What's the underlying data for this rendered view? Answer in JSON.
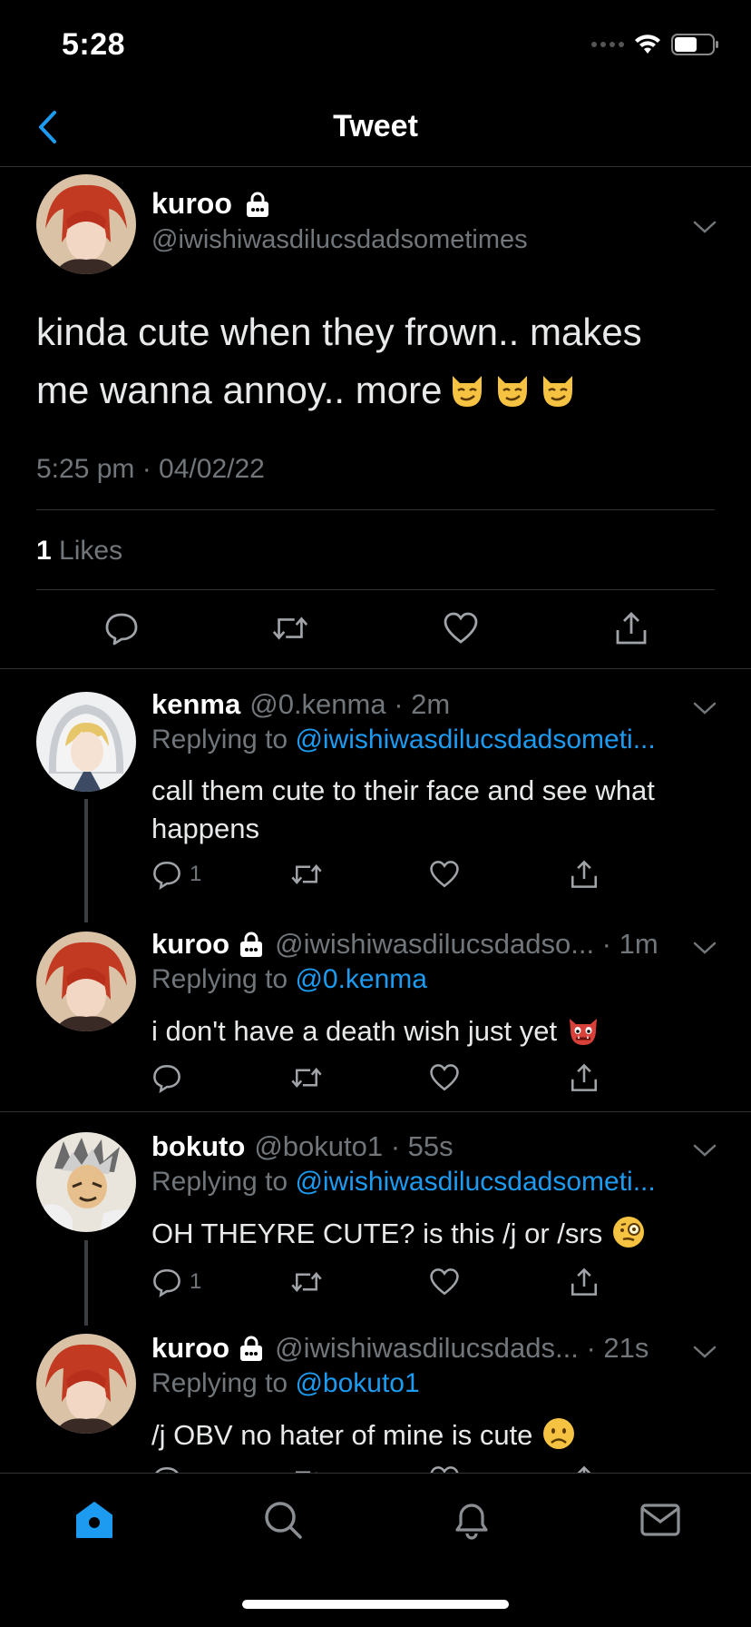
{
  "status": {
    "time": "5:28"
  },
  "nav": {
    "title": "Tweet"
  },
  "main_tweet": {
    "name": "kuroo",
    "handle": "@iwishiwasdilucsdadsometimes",
    "text_line1": "kinda cute when they frown.. makes",
    "text_line2": "me wanna annoy.. more",
    "timestamp": "5:25 pm · 04/02/22",
    "likes_count": "1",
    "likes_label": "Likes"
  },
  "replies": [
    {
      "name": "kenma",
      "meta": "@0.kenma · 2m",
      "replying_prefix": "Replying to ",
      "replying_to": "@iwishiwasdilucsdadsometi...",
      "text": "call them cute to their face and see what happens",
      "reply_count": "1"
    },
    {
      "name": "kuroo",
      "meta": "@iwishiwasdilucsdadso... · 1m",
      "replying_prefix": "Replying to ",
      "replying_to": "@0.kenma",
      "text": "i don't have a death wish just yet",
      "reply_count": ""
    },
    {
      "name": "bokuto",
      "meta": "@bokuto1 · 55s",
      "replying_prefix": "Replying to ",
      "replying_to": "@iwishiwasdilucsdadsometi...",
      "text": "OH THEYRE CUTE? is this /j or /srs",
      "reply_count": "1"
    },
    {
      "name": "kuroo",
      "meta": "@iwishiwasdilucsdads... · 21s",
      "replying_prefix": "Replying to ",
      "replying_to": "@bokuto1",
      "text": "/j OBV no hater of mine is cute",
      "reply_count": ""
    }
  ],
  "icons": {
    "back": "chevron-left-icon",
    "lock": "lock-icon",
    "reply": "comment-icon",
    "retweet": "retweet-icon",
    "like": "heart-icon",
    "share": "share-icon",
    "tabs": [
      "home-icon",
      "search-icon",
      "bell-icon",
      "mail-icon"
    ]
  },
  "colors": {
    "background": "#000000",
    "accent": "#1d9bf0",
    "secondary_text": "#71767b",
    "divider": "#2f3336"
  }
}
